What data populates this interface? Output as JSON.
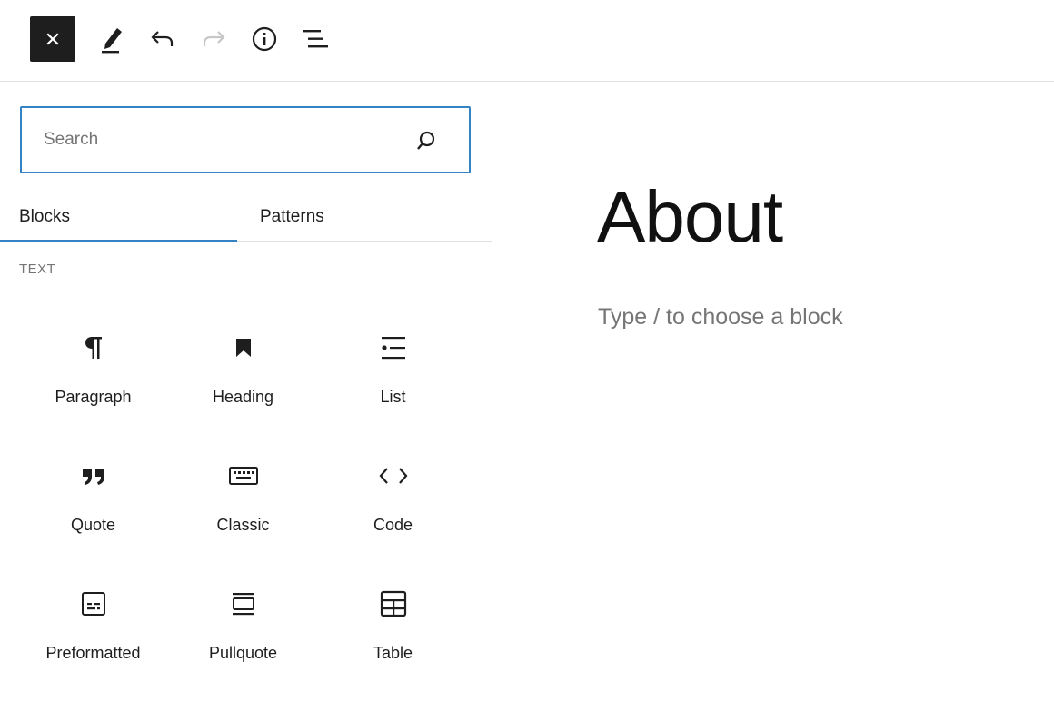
{
  "toolbar": {
    "close_icon": "close-icon",
    "tools_icon": "pencil-icon",
    "undo_icon": "undo-icon",
    "redo_icon": "redo-icon",
    "info_icon": "info-icon",
    "outline_icon": "list-view-icon"
  },
  "inserter": {
    "search": {
      "placeholder": "Search",
      "value": ""
    },
    "tabs": [
      {
        "label": "Blocks",
        "active": true
      },
      {
        "label": "Patterns",
        "active": false
      }
    ],
    "category": "TEXT",
    "blocks": [
      {
        "label": "Paragraph",
        "icon": "paragraph-icon"
      },
      {
        "label": "Heading",
        "icon": "bookmark-icon"
      },
      {
        "label": "List",
        "icon": "list-icon"
      },
      {
        "label": "Quote",
        "icon": "quote-icon"
      },
      {
        "label": "Classic",
        "icon": "keyboard-icon"
      },
      {
        "label": "Code",
        "icon": "code-icon"
      },
      {
        "label": "Preformatted",
        "icon": "preformatted-icon"
      },
      {
        "label": "Pullquote",
        "icon": "pullquote-icon"
      },
      {
        "label": "Table",
        "icon": "table-icon"
      }
    ]
  },
  "canvas": {
    "title": "About",
    "placeholder": "Type / to choose a block"
  },
  "colors": {
    "accent": "#3582c4",
    "text": "#1e1e1e",
    "muted": "#757575",
    "border": "#e0e0e0"
  }
}
